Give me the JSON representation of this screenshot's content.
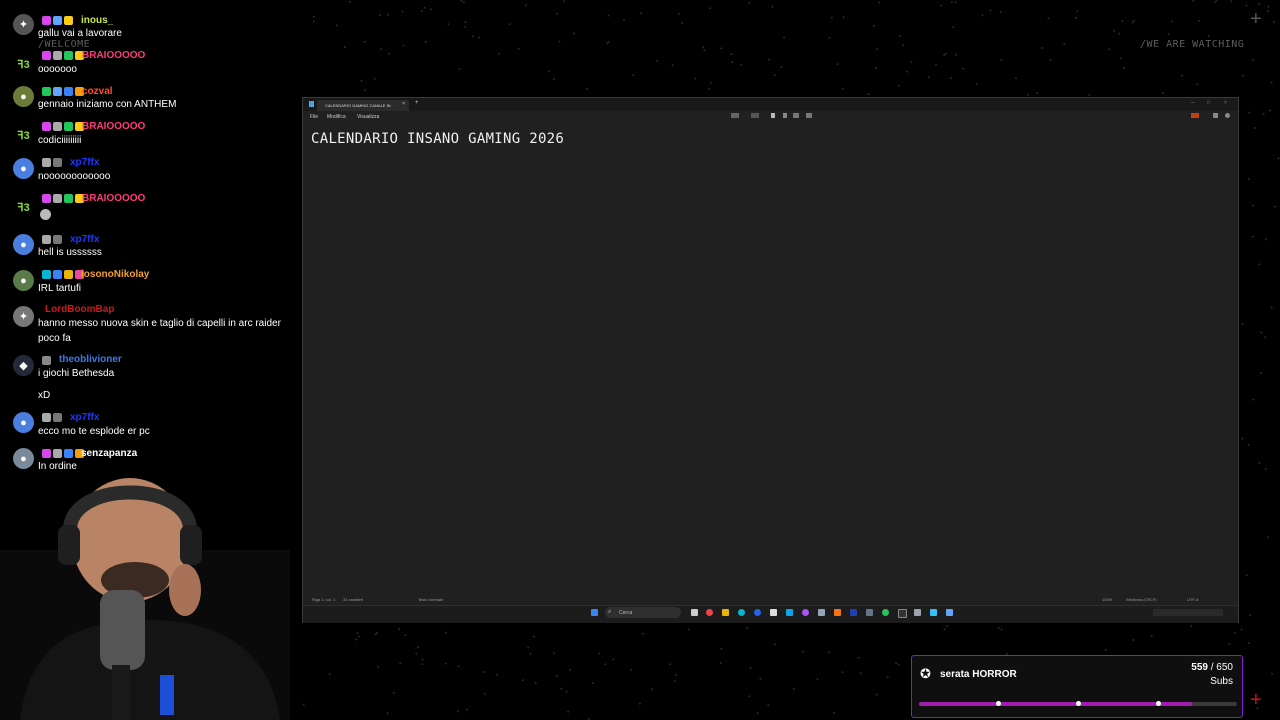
{
  "overlay": {
    "welcome_text": "/WELCOME",
    "watching_text": "/WE ARE WATCHING"
  },
  "chat": {
    "messages": [
      {
        "user": "inous_",
        "text": "gallu vai a lavorare",
        "color": "#c8e84a"
      },
      {
        "user": "BRAIOOOOO",
        "text": "ooooooo",
        "color": "#ff3a7a"
      },
      {
        "user": "cozval",
        "text": "gennaio iniziamo con ANTHEM",
        "color": "#ff4b2b"
      },
      {
        "user": "BRAIOOOOO",
        "text": "codiciiiiiiiii",
        "color": "#ff3a7a"
      },
      {
        "user": "xp7ffx",
        "text": "noooooooooooo",
        "color": "#1a38ff"
      },
      {
        "user": "BRAIOOOOO",
        "text": "",
        "color": "#ff3a7a"
      },
      {
        "user": "xp7ffx",
        "text": "hell is ussssss",
        "color": "#1a38ff"
      },
      {
        "user": "iosonoNikolay",
        "text": "IRL tartufi",
        "color": "#f0a030"
      },
      {
        "user": "LordBoomBap",
        "text": "hanno messo nuova skin e taglio di capelli in arc raider",
        "text2": "poco fa",
        "color": "#d01818"
      },
      {
        "user": "theoblivioner",
        "text": "i giochi Bethesda",
        "text2": "xD",
        "color": "#3a7ae8"
      },
      {
        "user": "xp7ffx",
        "text": "ecco mo te esplode er pc",
        "color": "#1a38ff"
      },
      {
        "user": "senzapanza",
        "text": "In ordine",
        "color": "#ffffff"
      }
    ]
  },
  "notepad": {
    "tab_title": "CALENDARIO GAMING CANALE IN",
    "menu": [
      "File",
      "Modifica",
      "Visualizza"
    ],
    "content": "CALENDARIO INSANO GAMING 2026",
    "status": {
      "position": "Riga 1, col. 1",
      "chars": "31 caratteri",
      "format": "Testo normale",
      "zoom": "100%",
      "eol": "Windows (CRLF)",
      "encoding": "UTF-8"
    },
    "taskbar": {
      "search_placeholder": "Cerca"
    }
  },
  "goal": {
    "title": "serata HORROR",
    "current": 559,
    "target": 650,
    "count_text": "559",
    "target_text": " / 650",
    "unit": "Subs",
    "progress": 0.86,
    "accent": "#a21caf"
  }
}
